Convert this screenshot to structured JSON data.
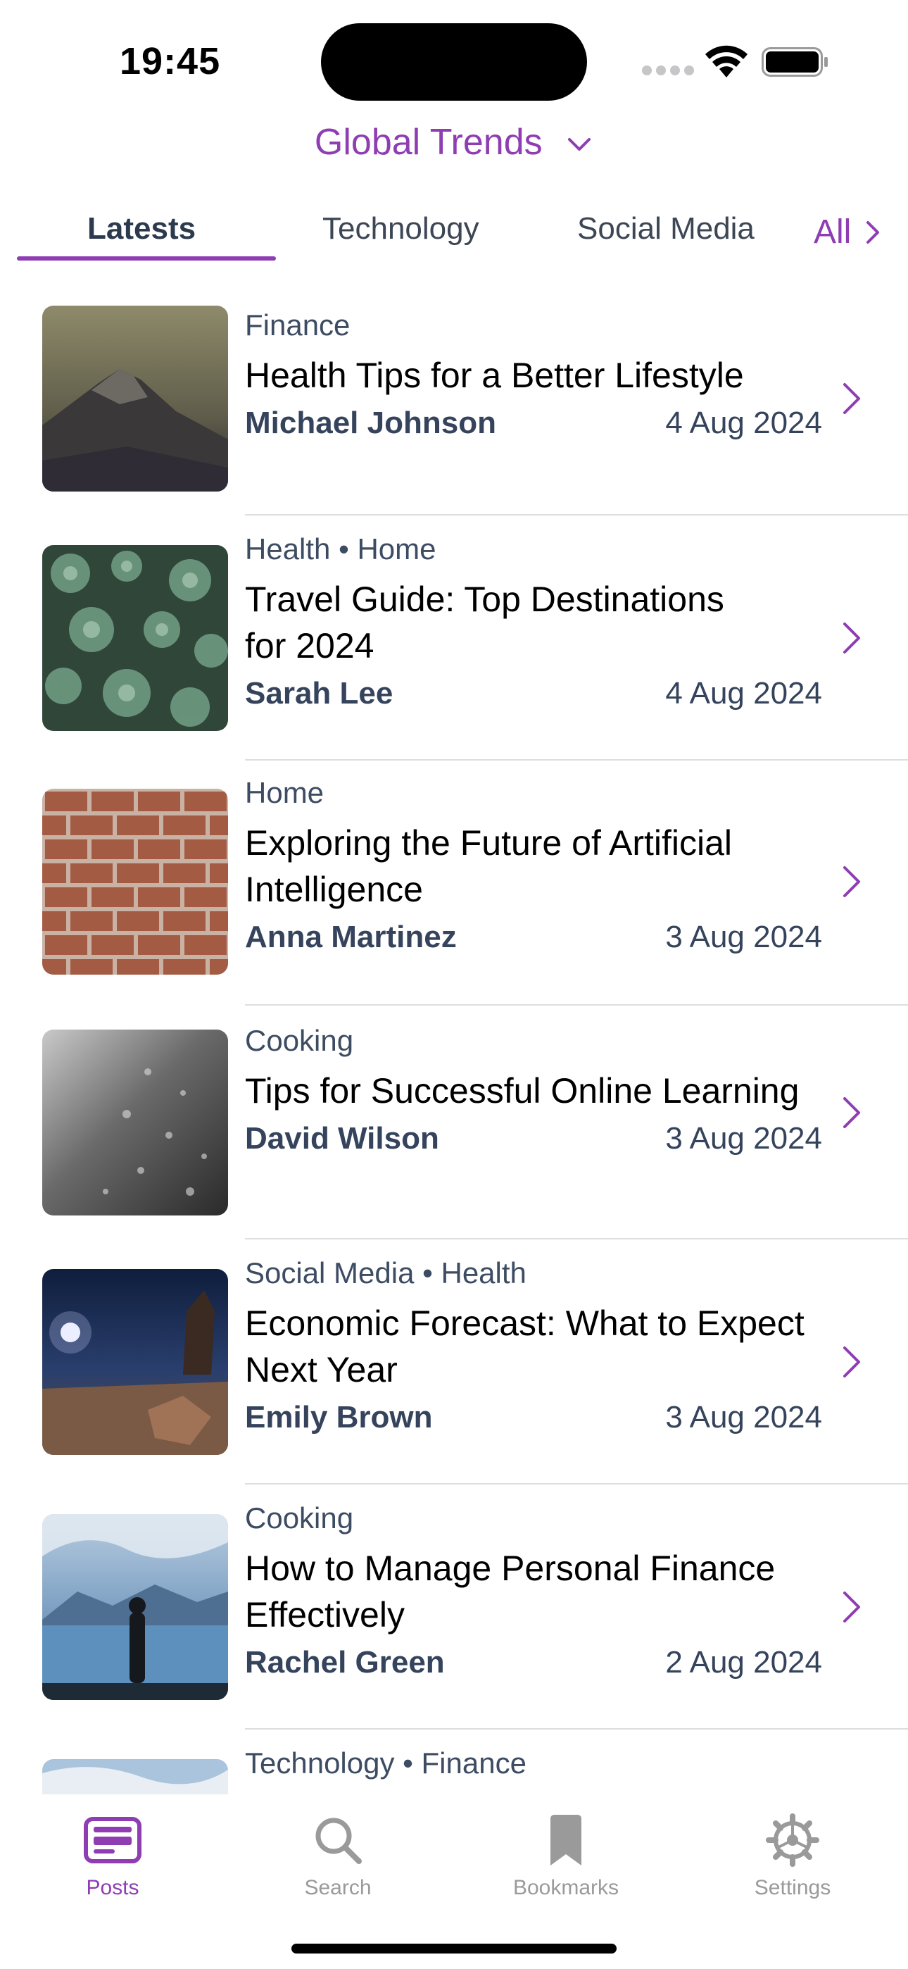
{
  "status_bar": {
    "time": "19:45"
  },
  "header": {
    "title": "Global Trends"
  },
  "tabs": {
    "items": [
      {
        "label": "Latests",
        "active": true
      },
      {
        "label": "Technology",
        "active": false
      },
      {
        "label": "Social Media",
        "active": false
      }
    ],
    "all_label": "All"
  },
  "posts": [
    {
      "category": "Finance",
      "title": "Health Tips for a Better Lifestyle",
      "author": "Michael Johnson",
      "date": "4 Aug 2024",
      "image": "mountain"
    },
    {
      "category": "Health • Home",
      "title": "Travel Guide: Top Destinations for 2024",
      "author": "Sarah Lee",
      "date": "4 Aug 2024",
      "image": "succulents"
    },
    {
      "category": "Home",
      "title": "Exploring the Future of Artificial Intelligence",
      "author": "Anna Martinez",
      "date": "3 Aug 2024",
      "image": "brick-wall"
    },
    {
      "category": "Cooking",
      "title": "Tips for Successful Online Learning",
      "author": "David Wilson",
      "date": "3 Aug 2024",
      "image": "rain-drops"
    },
    {
      "category": "Social Media • Health",
      "title": "Economic Forecast: What to Expect Next Year",
      "author": "Emily Brown",
      "date": "3 Aug 2024",
      "image": "night-desert"
    },
    {
      "category": "Cooking",
      "title": "How to Manage Personal Finance Effectively",
      "author": "Rachel Green",
      "date": "2 Aug 2024",
      "image": "person-lake"
    },
    {
      "category": "Technology • Finance",
      "title": "",
      "author": "",
      "date": "",
      "image": "sky"
    }
  ],
  "tabbar": {
    "items": [
      {
        "label": "Posts",
        "icon": "posts-icon",
        "active": true
      },
      {
        "label": "Search",
        "icon": "search-icon",
        "active": false
      },
      {
        "label": "Bookmarks",
        "icon": "bookmark-icon",
        "active": false
      },
      {
        "label": "Settings",
        "icon": "gear-icon",
        "active": false
      }
    ]
  },
  "colors": {
    "accent": "#8e3db3",
    "text_secondary": "#35445c",
    "inactive": "#9a9a9a"
  }
}
